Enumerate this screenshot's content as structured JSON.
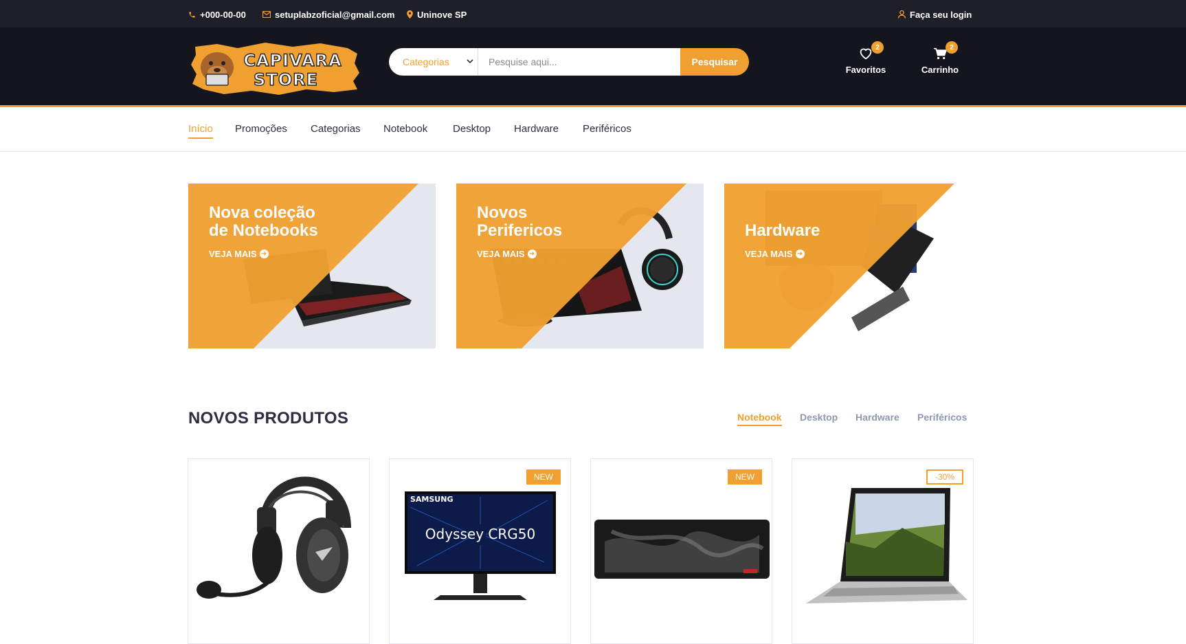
{
  "topbar": {
    "phone": "+000-00-00",
    "email": "setuplabzoficial@gmail.com",
    "location": "Uninove SP",
    "login": "Faça seu login"
  },
  "logo": {
    "line1": "CAPIVARA",
    "line2": "STORE"
  },
  "search": {
    "category_label": "Categorias",
    "placeholder": "Pesquise aqui...",
    "button": "Pesquisar"
  },
  "header_actions": {
    "favorites": {
      "label": "Favoritos",
      "count": "2"
    },
    "cart": {
      "label": "Carrinho",
      "count": "2"
    }
  },
  "nav": {
    "items": [
      "Início",
      "Promoções",
      "Categorias",
      "Notebook",
      "Desktop",
      "Hardware",
      "Periféricos"
    ],
    "active": "Início"
  },
  "banners": [
    {
      "title": "Nova coleção\nde Notebooks",
      "cta": "VEJA MAIS"
    },
    {
      "title": "Novos\nPerifericos",
      "cta": "VEJA MAIS"
    },
    {
      "title": "Hardware",
      "cta": "VEJA MAIS"
    }
  ],
  "section": {
    "title": "NOVOS PRODUTOS",
    "tabs": [
      "Notebook",
      "Desktop",
      "Hardware",
      "Periféricos"
    ],
    "active_tab": "Notebook"
  },
  "products": [
    {
      "image": "headset",
      "tag": ""
    },
    {
      "image": "monitor",
      "tag": "NEW",
      "brand": "SAMSUNG",
      "model": "Odyssey CRG50"
    },
    {
      "image": "mousepad",
      "tag": "NEW"
    },
    {
      "image": "laptop",
      "tag": "-30%"
    }
  ],
  "colors": {
    "accent": "#f0a030",
    "dark": "#15161d",
    "topbar": "#1e1f29",
    "text": "#2b2d42"
  }
}
